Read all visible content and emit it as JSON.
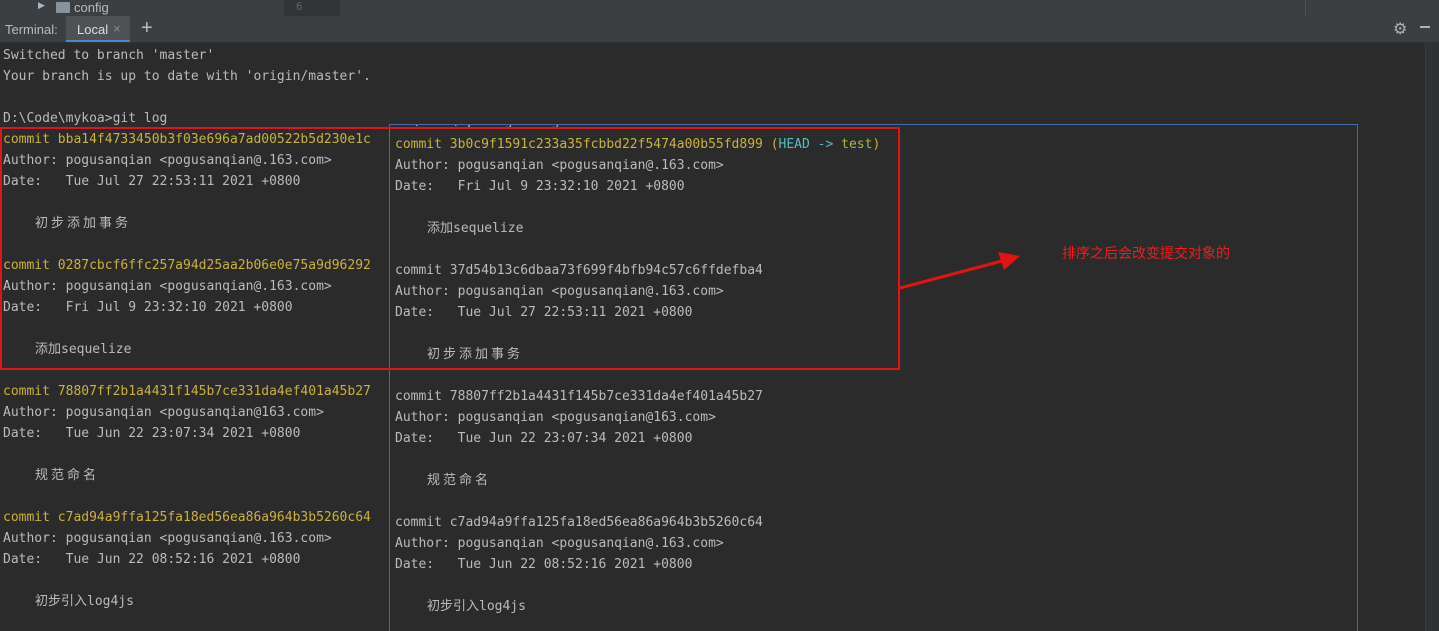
{
  "tree": {
    "folder_label": "config",
    "line_number": "6"
  },
  "toolbar": {
    "title": "Terminal:",
    "tab_label": "Local",
    "tab_close": "×",
    "add_label": "+"
  },
  "terminal": {
    "switched": "Switched to branch 'master'",
    "uptodate": "Your branch is up to date with 'origin/master'.",
    "prompt": "D:\\Code\\mykoa>git log",
    "commits": [
      {
        "commit": "commit bba14f4733450b3f03e696a7ad00522b5d230e1c",
        "author": "Author: pogusanqian <pogusanqian@.163.com>",
        "date": "Date:   Tue Jul 27 22:53:11 2021 +0800",
        "msg": "初步添加事务"
      },
      {
        "commit": "commit 0287cbcf6ffc257a94d25aa2b06e0e75a9d96292",
        "author": "Author: pogusanqian <pogusanqian@.163.com>",
        "date": "Date:   Fri Jul 9 23:32:10 2021 +0800",
        "msg": "添加sequelize"
      },
      {
        "commit": "commit 78807ff2b1a4431f145b7ce331da4ef401a45b27",
        "author": "Author: pogusanqian <pogusanqian@163.com>",
        "date": "Date:   Tue Jun 22 23:07:34 2021 +0800",
        "msg": "规范命名"
      },
      {
        "commit": "commit c7ad94a9ffa125fa18ed56ea86a964b3b5260c64",
        "author": "Author: pogusanqian <pogusanqian@.163.com>",
        "date": "Date:   Tue Jun 22 08:52:16 2021 +0800",
        "msg": "初步引入log4js"
      }
    ]
  },
  "overlay": {
    "peek": "D:\\Code\\mykoa>git log",
    "head_open": "(",
    "head_label": "HEAD ->",
    "head_branch": "test",
    "head_close": ")",
    "commits": [
      {
        "commit": "commit 3b0c9f1591c233a35fcbbd22f5474a00b55fd899",
        "author": "Author: pogusanqian <pogusanqian@.163.com>",
        "date": "Date:   Fri Jul 9 23:32:10 2021 +0800",
        "msg": "添加sequelize"
      },
      {
        "commit": "commit 37d54b13c6dbaa73f699f4bfb94c57c6ffdefba4",
        "author": "Author: pogusanqian <pogusanqian@.163.com>",
        "date": "Date:   Tue Jul 27 22:53:11 2021 +0800",
        "msg": "初步添加事务"
      },
      {
        "commit": "commit 78807ff2b1a4431f145b7ce331da4ef401a45b27",
        "author": "Author: pogusanqian <pogusanqian@163.com>",
        "date": "Date:   Tue Jun 22 23:07:34 2021 +0800",
        "msg": "规范命名"
      },
      {
        "commit": "commit c7ad94a9ffa125fa18ed56ea86a964b3b5260c64",
        "author": "Author: pogusanqian <pogusanqian@.163.com>",
        "date": "Date:   Tue Jun 22 08:52:16 2021 +0800",
        "msg": "初步引入log4js"
      }
    ]
  },
  "annotation": {
    "text": "排序之后会改变提交对象的",
    "color": "#e82020"
  },
  "colors": {
    "commit_hash": "#ccb13a",
    "head_ref": "#56bdc1",
    "branch": "#a0b84c",
    "highlight_box": "#e01414",
    "overlay_border": "#3f6fa8"
  }
}
